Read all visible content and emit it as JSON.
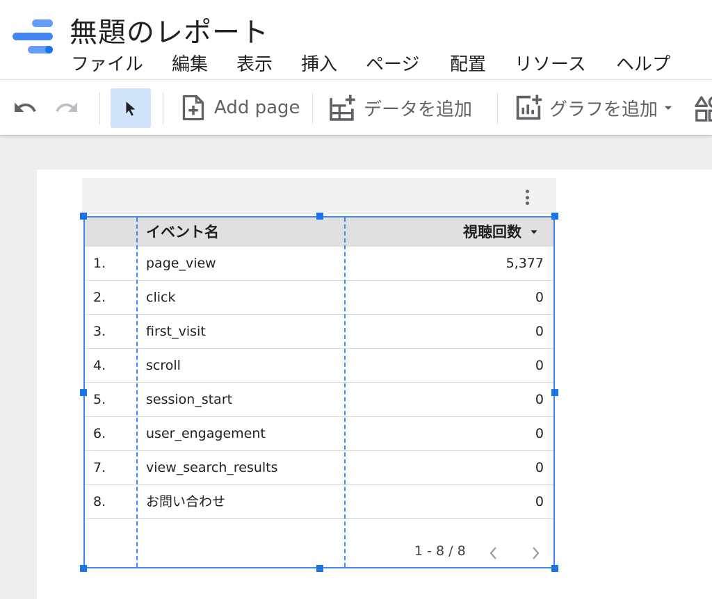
{
  "app": {
    "title": "無題のレポート",
    "accent_color": "#4285f4",
    "logo_icon": "looker-studio-logo"
  },
  "menu": [
    "ファイル",
    "編集",
    "表示",
    "挿入",
    "ページ",
    "配置",
    "リソース",
    "ヘルプ"
  ],
  "toolbar": {
    "add_page_label": "Add page",
    "add_data_label": "データを追加",
    "add_chart_label": "グラフを追加"
  },
  "table": {
    "headers": {
      "dimension": "イベント名",
      "metric": "視聴回数"
    },
    "sort": "descending",
    "rows": [
      {
        "index": "1.",
        "name": "page_view",
        "value": "5,377"
      },
      {
        "index": "2.",
        "name": "click",
        "value": "0"
      },
      {
        "index": "3.",
        "name": "first_visit",
        "value": "0"
      },
      {
        "index": "4.",
        "name": "scroll",
        "value": "0"
      },
      {
        "index": "5.",
        "name": "session_start",
        "value": "0"
      },
      {
        "index": "6.",
        "name": "user_engagement",
        "value": "0"
      },
      {
        "index": "7.",
        "name": "view_search_results",
        "value": "0"
      },
      {
        "index": "8.",
        "name": "お問い合わせ",
        "value": "0"
      }
    ],
    "pagination": "1 - 8 / 8"
  }
}
